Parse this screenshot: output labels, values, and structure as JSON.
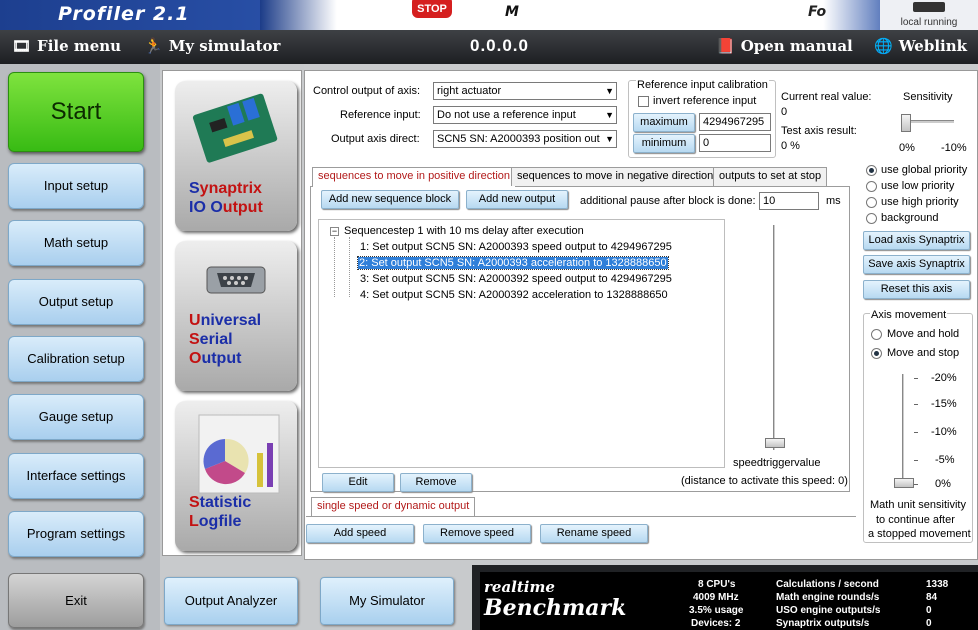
{
  "banner": {
    "title": "Profiler 2.1",
    "stop": "STOP",
    "word_a": "M",
    "word_b": "Fo",
    "local_running": "local running"
  },
  "menubar": {
    "file_menu": "File menu",
    "my_simulator": "My simulator",
    "version": "0.0.0.0",
    "open_manual": "Open manual",
    "weblink": "Weblink"
  },
  "nav": {
    "start": "Start",
    "items": [
      "Input setup",
      "Math setup",
      "Output setup",
      "Calibration setup",
      "Gauge setup",
      "Interface settings",
      "Program settings"
    ],
    "exit": "Exit"
  },
  "modules": [
    {
      "w1a": "S",
      "w1b": "ynaptrix",
      "w2a": "IO ",
      "w2b": "O",
      "w2c": "utput"
    },
    {
      "l1a": "U",
      "l1b": "niversal",
      "l2a": "S",
      "l2b": "erial",
      "l3a": "O",
      "l3b": "utput"
    },
    {
      "l1a": "S",
      "l1b": "tatistic",
      "l2a": "L",
      "l2b": "ogfile"
    }
  ],
  "control": {
    "axis_label": "Control output of axis:",
    "axis_value": "right actuator",
    "refinput_label": "Reference input:",
    "refinput_value": "Do not use a reference input",
    "outaxis_label": "Output axis direct:",
    "outaxis_value": "SCN5 SN: A2000393 position out"
  },
  "calibration": {
    "title": "Reference input calibration",
    "invert_label": "invert reference input",
    "maximum_btn": "maximum",
    "maximum_value": "4294967295",
    "minimum_btn": "minimum",
    "minimum_value": "0",
    "current_label": "Current real value:",
    "current_value": "0",
    "test_label": "Test axis result:",
    "test_value": "0 %"
  },
  "sensitivity": {
    "title": "Sensitivity",
    "left_label": "0%",
    "right_label": "-10%",
    "level_fraction": 0.0
  },
  "tabs": [
    "sequences to move in positive direction",
    "sequences to move in negative direction",
    "outputs to set at stop"
  ],
  "sequence": {
    "add_block": "Add new sequence block",
    "add_output": "Add new output",
    "pause_label": "additional pause after block is done:",
    "pause_value": "10",
    "pause_unit": "ms",
    "root": "Sequencestep 1 with 10 ms delay after execution",
    "root_toggle": "−",
    "items": [
      "1: Set output SCN5 SN: A2000393 speed output to 4294967295",
      "2: Set output SCN5 SN: A2000393 acceleration to 1328888650",
      "3: Set output SCN5 SN: A2000392 speed output to 4294967295",
      "4: Set output SCN5 SN: A2000392 acceleration to 1328888650"
    ],
    "selected_index": 1,
    "edit": "Edit",
    "remove": "Remove",
    "speedtrigger_label": "speedtriggervalue",
    "speedtrigger_note": "(distance to activate this speed: 0)",
    "speedtrigger_fraction": 0.0
  },
  "speed_tab": "single speed or dynamic output",
  "speed_buttons": [
    "Add speed",
    "Remove speed",
    "Rename speed"
  ],
  "priority": {
    "options": [
      "use global priority",
      "use low priority",
      "use high priority",
      "background"
    ],
    "selected": 0
  },
  "axis_buttons": [
    "Load axis Synaptrix",
    "Save axis Synaptrix",
    "Reset this axis"
  ],
  "axis_movement": {
    "title": "Axis movement",
    "options": [
      "Move and hold",
      "Move and stop"
    ],
    "selected": 1,
    "scale": [
      "-20%",
      "-15%",
      "-10%",
      "-5%",
      "0%"
    ],
    "level_fraction": 0.0,
    "note_lines": [
      "Math unit sensitivity",
      "to continue after",
      "a stopped movement"
    ]
  },
  "bottom": {
    "output_analyzer": "Output Analyzer",
    "my_simulator": "My Simulator"
  },
  "benchmark": {
    "logo_line1": "realtime",
    "logo_line2": "Benchmark",
    "cpu_lines": [
      "8 CPU's",
      "4009 MHz",
      "3.5% usage",
      "Devices: 2"
    ],
    "metric_labels": [
      "Calculations / second",
      "Math engine rounds/s",
      "USO engine outputs/s",
      "Synaptrix outputs/s"
    ],
    "metric_values": [
      "1338",
      "84",
      "0",
      "0"
    ]
  },
  "colors": {
    "accent_red": "#b21a1a",
    "start_green": "#4cc61f",
    "button_blue": "#b7d9f1",
    "selection": "#2f7fd9"
  }
}
